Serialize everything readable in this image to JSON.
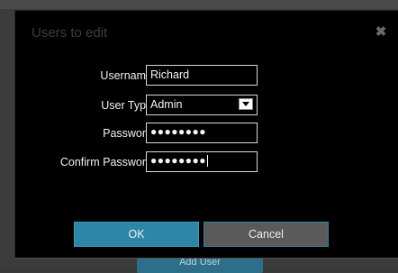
{
  "dialog": {
    "title": "Users to edit",
    "close_glyph": "✖",
    "fields": {
      "username": {
        "label": "Username",
        "value": "Richard"
      },
      "user_type": {
        "label": "User Type",
        "value": "Admin"
      },
      "password": {
        "label": "Password",
        "value": "●●●●●●●●"
      },
      "confirm_password": {
        "label": "Confirm Password",
        "value": "●●●●●●●●"
      }
    },
    "ok_label": "OK",
    "cancel_label": "Cancel"
  },
  "background": {
    "button_label": "Add User"
  },
  "colors": {
    "accent": "#2e86a6",
    "dialog_bg": "#000000",
    "cancel_bg": "#5a5a5a"
  },
  "icons": [
    "close-icon",
    "dropdown-arrow-icon"
  ]
}
